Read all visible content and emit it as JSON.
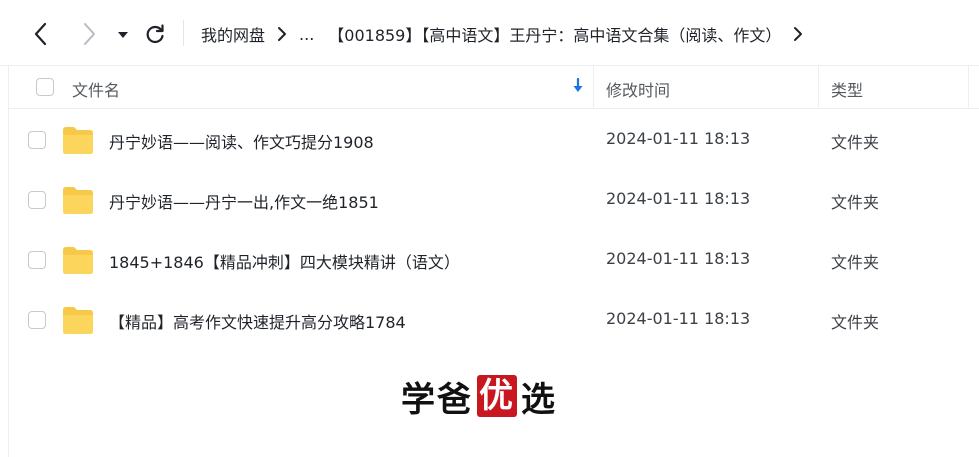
{
  "toolbar": {
    "breadcrumb": {
      "root": "我的网盘",
      "ellipsis": "...",
      "current": "【001859】【高中语文】王丹宁：高中语文合集（阅读、作文）"
    }
  },
  "table": {
    "columns": {
      "name": "文件名",
      "modified": "修改时间",
      "type": "类型"
    },
    "rows": [
      {
        "name": "丹宁妙语——阅读、作文巧提分1908",
        "modified": "2024-01-11 18:13",
        "type": "文件夹"
      },
      {
        "name": "丹宁妙语——丹宁一出,作文一绝1851",
        "modified": "2024-01-11 18:13",
        "type": "文件夹"
      },
      {
        "name": "1845+1846【精品冲刺】四大模块精讲（语文）",
        "modified": "2024-01-11 18:13",
        "type": "文件夹"
      },
      {
        "name": "【精品】高考作文快速提升高分攻略1784",
        "modified": "2024-01-11 18:13",
        "type": "文件夹"
      }
    ]
  },
  "watermark": {
    "char1": "学",
    "char2": "爸",
    "seal_char": "优",
    "char4": "选"
  },
  "colors": {
    "folder": "#f7c948",
    "sort_arrow": "#1a73e8",
    "seal": "#c8171e"
  },
  "icons": {
    "back": "chevron-left-icon",
    "forward": "chevron-right-icon",
    "dropdown": "caret-down-icon",
    "refresh": "refresh-icon",
    "sort": "arrow-down-icon",
    "folder": "folder-icon"
  }
}
